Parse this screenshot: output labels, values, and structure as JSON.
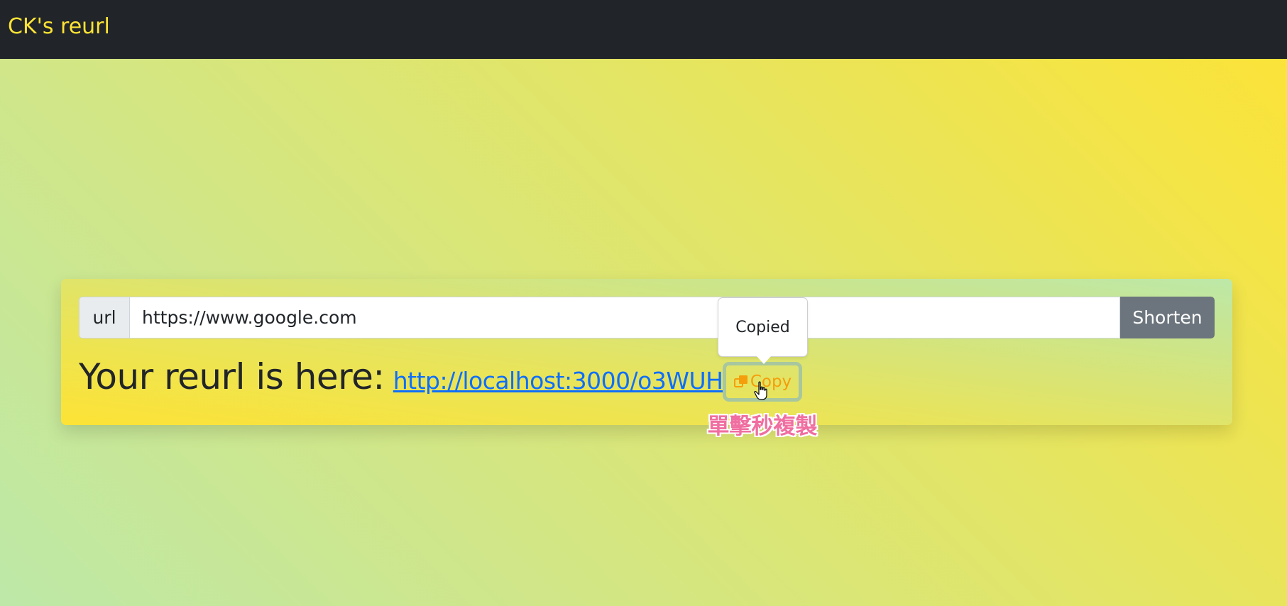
{
  "app": {
    "brand": "CK's reurl"
  },
  "form": {
    "addon_label": "url",
    "input_value": "https://www.google.com",
    "shorten_label": "Shorten"
  },
  "result": {
    "label": "Your reurl is here:",
    "link": "http://localhost:3000/o3WUH",
    "copy_label": "Copy",
    "tooltip": "Copied",
    "hint": "單擊秒複製"
  },
  "icons": {
    "copy": "copy-icon",
    "cursor": "hand-pointer-icon"
  },
  "colors": {
    "navbar": "#212429",
    "brand": "#fde335",
    "link": "#0d6efd",
    "copy": "#f59e0b",
    "hint": "#f06ea0",
    "shorten_bg": "#6c757d"
  }
}
